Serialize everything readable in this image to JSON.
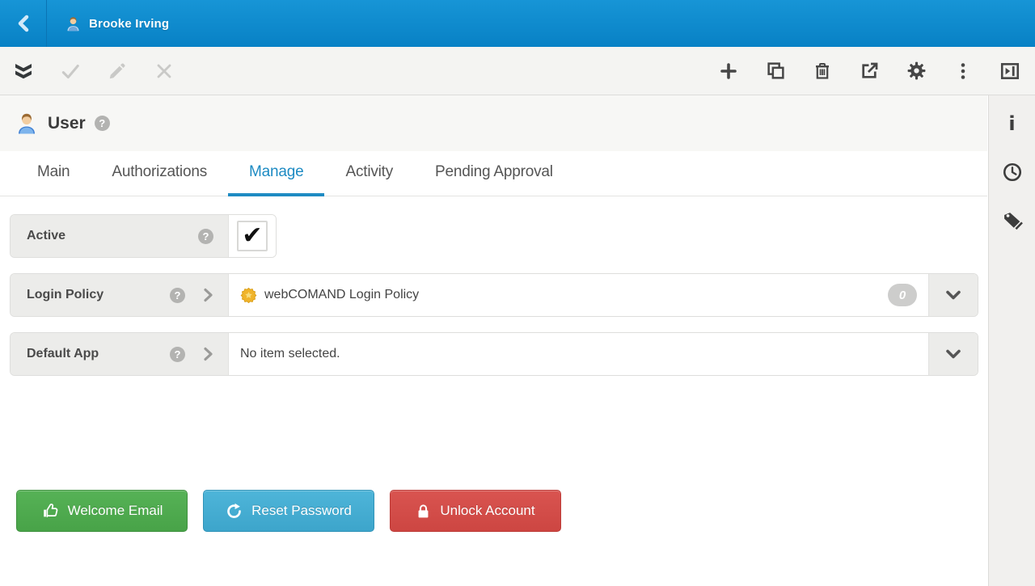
{
  "colors": {
    "topbar_blue_top": "#1795d6",
    "topbar_blue_bottom": "#0881c5",
    "accent_blue": "#1e8bc3",
    "button_green": "#4da84d",
    "button_light_blue": "#45aed2",
    "button_red": "#d4504c"
  },
  "topbar": {
    "user_name": "Brooke Irving"
  },
  "toolbar": {
    "left_icons": [
      "collapse-all",
      "approve",
      "edit",
      "close"
    ],
    "right_icons": [
      "add",
      "duplicate",
      "delete",
      "open-external",
      "settings",
      "more",
      "toggle-panel"
    ]
  },
  "page": {
    "title": "User",
    "help_glyph": "?"
  },
  "tabs": {
    "items": [
      {
        "label": "Main",
        "active": false
      },
      {
        "label": "Authorizations",
        "active": false
      },
      {
        "label": "Manage",
        "active": true
      },
      {
        "label": "Activity",
        "active": false
      },
      {
        "label": "Pending Approval",
        "active": false
      }
    ]
  },
  "fields": {
    "active": {
      "label": "Active",
      "checked": true,
      "check_glyph": "✔"
    },
    "login_policy": {
      "label": "Login Policy",
      "value": "webCOMAND Login Policy",
      "count": "0"
    },
    "default_app": {
      "label": "Default App",
      "value": "No item selected."
    }
  },
  "actions": {
    "welcome_email": "Welcome Email",
    "reset_password": "Reset Password",
    "unlock_account": "Unlock Account"
  },
  "sidebar": {
    "icons": [
      "info",
      "history",
      "tags"
    ],
    "info_glyph": "i"
  }
}
